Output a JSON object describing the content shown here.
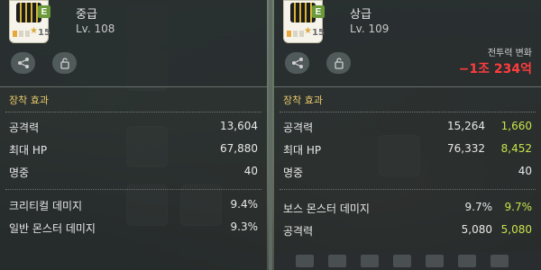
{
  "left": {
    "grade_badge": "E",
    "icon_level": "15",
    "grade": "중급",
    "level": "Lv. 108",
    "section_title": "장착 효과",
    "stats": [
      {
        "label": "공격력",
        "value": "13,604"
      },
      {
        "label": "최대 HP",
        "value": "67,880"
      },
      {
        "label": "명중",
        "value": "40"
      }
    ],
    "potentials": [
      {
        "label": "크리티컬 데미지",
        "value": "9.4%"
      },
      {
        "label": "일반 몬스터 데미지",
        "value": "9.3%"
      }
    ]
  },
  "right": {
    "grade_badge": "E",
    "icon_level": "15",
    "grade": "상급",
    "level": "Lv. 109",
    "power_label": "전투력 변화",
    "power_value": "−1조 234억",
    "section_title": "장착 효과",
    "stats": [
      {
        "label": "공격력",
        "value": "15,264",
        "bonus": "1,660"
      },
      {
        "label": "최대 HP",
        "value": "76,332",
        "bonus": "8,452"
      },
      {
        "label": "명중",
        "value": "40"
      }
    ],
    "potentials": [
      {
        "label": "보스 몬스터 데미지",
        "value": "9.7%",
        "bonus": "9.7%"
      },
      {
        "label": "공격력",
        "value": "5,080",
        "bonus": "5,080"
      }
    ]
  },
  "colors": {
    "bonus": "#c9e34a",
    "power_negative": "#ff3c3c",
    "section_title": "#e9c86a"
  },
  "icons": [
    "share-icon",
    "lock-icon",
    "star-icon",
    "boots-icon"
  ]
}
